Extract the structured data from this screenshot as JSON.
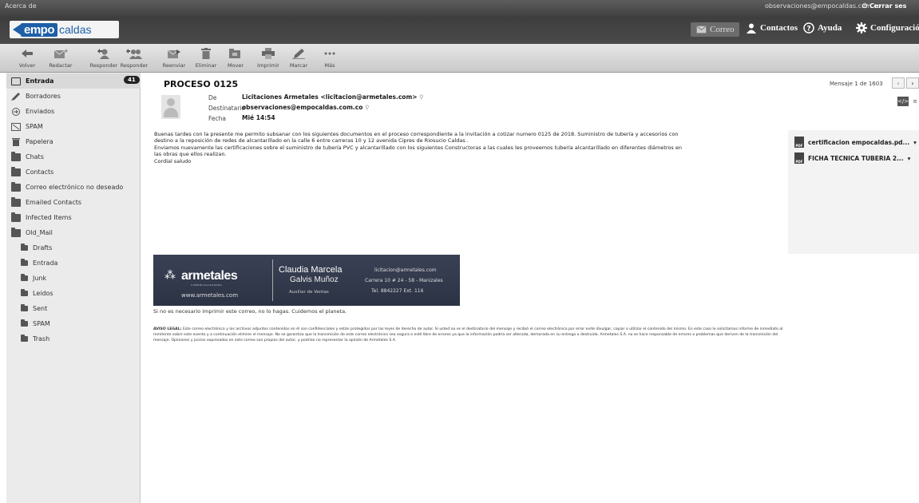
{
  "header": {
    "acerca": "Acerca de",
    "user_email": "observaciones@empocaldas.com.co",
    "logout": "Cerrar ses",
    "logo_em": "empo",
    "logo_caldas": "caldas",
    "nav": {
      "correo": "Correo",
      "contactos": "Contactos",
      "ayuda": "Ayuda",
      "configuracion": "Configuración"
    }
  },
  "toolbar": {
    "volver": "Volver",
    "redactar": "Redactar",
    "responder": "Responder",
    "responder_todos": "Responder",
    "reenviar": "Reenviar",
    "eliminar": "Eliminar",
    "mover": "Mover",
    "imprimir": "Imprimir",
    "marcar": "Marcar",
    "mas": "Más"
  },
  "sidebar": {
    "unread": "41",
    "items": [
      {
        "label": "Entrada"
      },
      {
        "label": "Borradores"
      },
      {
        "label": "Enviados"
      },
      {
        "label": "SPAM"
      },
      {
        "label": "Papelera"
      },
      {
        "label": "Chats"
      },
      {
        "label": "Contacts"
      },
      {
        "label": "Correo electrónico no deseado"
      },
      {
        "label": "Emailed Contacts"
      },
      {
        "label": "Infected Items"
      },
      {
        "label": "Old_Mail"
      },
      {
        "label": "Drafts"
      },
      {
        "label": "Entrada"
      },
      {
        "label": "Junk"
      },
      {
        "label": "Leidos"
      },
      {
        "label": "Sent"
      },
      {
        "label": "SPAM"
      },
      {
        "label": "Trash"
      }
    ]
  },
  "message": {
    "subject": "PROCESO 0125",
    "counter": "Mensaje 1 de 1603",
    "de_label": "De",
    "de_value": "Licitaciones Armetales <licitacion@armetales.com>",
    "para_label": "Destinatario",
    "para_value": "observaciones@empocaldas.com.co",
    "fecha_label": "Fecha",
    "fecha_value": "Mié 14:54",
    "body": [
      "Buenas tardes con la presente me permito subsanar con los siguientes documentos en el proceso correspondiente a la invitación a cotizar numero 0125 de 2018. Suministro de tubería y accesorios con",
      "destino a la reposición de redes de alcantarillado en la calle 6 entre carreras 10 y 12  avenida Cipres de Riosucio Caldas .",
      "Enviamos nuevamente las certificaciones sobre el suministro de tubería PVC y alcantarillado con los siguientes Constructoras a las cuales les proveemos  tubería alcantarillado  en diferentes diámetros en",
      "las obras que ellos realizan.",
      "Cordial saludo"
    ],
    "attachments": [
      {
        "name": "certificacion empocaldas.pd...",
        "type": "PDF"
      },
      {
        "name": "FICHA TECNICA TUBERIA 2...",
        "type": "PDF"
      }
    ],
    "signature": {
      "brand": "armetales",
      "tagline": "COMERCIALIZADORA",
      "web": "www.armetales.com",
      "name1": "Claudia Marcela",
      "name2": "Galvis Muñoz",
      "role": "Auxiliar de Ventas",
      "email": "licitacion@armetales.com",
      "address": "Carrera 10 # 24 - 58 - Manizales",
      "phone": "Tel. 8842227 Ext. 116"
    },
    "noprint": "Si no es necesario imprimir este correo, no lo hagas. Cuidemos el planeta.",
    "legal_title": "AVISO LEGAL:",
    "legal_text": "Este correo electrónico y los archivos adjuntos contenidos en él son confidenciales y están protegidos por las leyes de derecho de autor. Si usted no es el destinatario del mensaje y recibió el correo electrónico por error evite divulgar, copiar o utilizar el contenido del mismo. En este caso le solicitamos informe de inmediato al remitente sobre este evento y a continuación elimine el mensaje. No se garantiza que la transmisión de este correo electrónico sea segura o esté libre de errores ya que la información podría ser alterada, demorada en su entrega o destruida. Armetales S.A. no se hace responsable de errores o problemas que deriven de la transmisión del mensaje. Opiniones y juicios expresados en este correo son propios del autor, y podrían no representar la opinión de Armetales S.A."
  }
}
